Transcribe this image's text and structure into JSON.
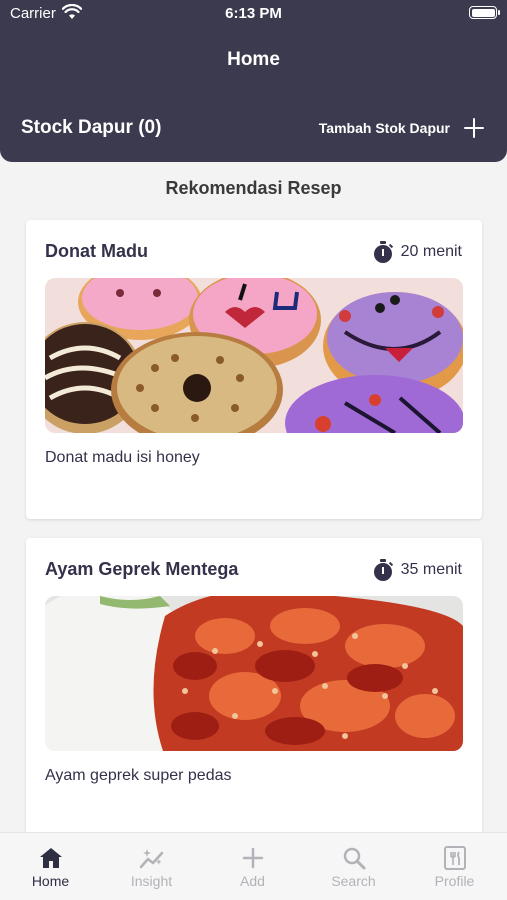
{
  "status_bar": {
    "carrier": "Carrier",
    "time": "6:13 PM"
  },
  "header": {
    "title": "Home",
    "stock_title": "Stock Dapur (0)",
    "add_stock_label": "Tambah Stok Dapur"
  },
  "section_title": "Rekomendasi Resep",
  "recipes": [
    {
      "title": "Donat Madu",
      "time": "20 menit",
      "description": "Donat madu isi honey",
      "image_icon": "donut-photo"
    },
    {
      "title": "Ayam Geprek Mentega",
      "time": "35 menit",
      "description": "Ayam geprek super pedas",
      "image_icon": "fried-chicken-photo"
    }
  ],
  "tabbar": {
    "items": [
      {
        "label": "Home",
        "icon": "home-icon",
        "active": true
      },
      {
        "label": "Insight",
        "icon": "insight-icon",
        "active": false
      },
      {
        "label": "Add",
        "icon": "add-icon",
        "active": false
      },
      {
        "label": "Search",
        "icon": "search-icon",
        "active": false
      },
      {
        "label": "Profile",
        "icon": "profile-icon",
        "active": false
      }
    ]
  },
  "colors": {
    "header_bg": "#3b3a4f",
    "text_dark": "#34324a",
    "tab_inactive": "#b2b2b8",
    "background": "#f3f3f4"
  }
}
